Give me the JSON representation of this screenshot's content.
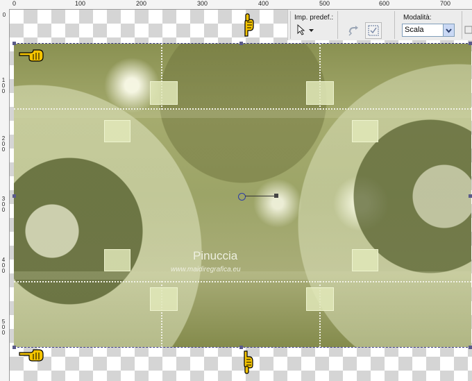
{
  "ruler": {
    "top_labels": [
      "0",
      "100",
      "200",
      "300",
      "400",
      "500",
      "600",
      "700"
    ],
    "left_labels": [
      "0",
      "1 0 0",
      "2 0 0",
      "3 0 0",
      "4 0 0",
      "5 0 0"
    ]
  },
  "toolbar": {
    "preset_label": "Imp. predef.:",
    "mode_label": "Modalità:",
    "mode_value": "Scala"
  },
  "watermark": {
    "name": "Pinuccia",
    "url": "www.maidiregrafica.eu"
  },
  "icons": [
    "pointing-hand-icon",
    "pick-tool-icon",
    "reset-icon",
    "apply-icon",
    "chevron-down-icon"
  ],
  "colors": {
    "image_base": "#9ca467",
    "guide": "#f1f1e6",
    "handle": "#3b3b8a",
    "hand": "#f0c000"
  }
}
